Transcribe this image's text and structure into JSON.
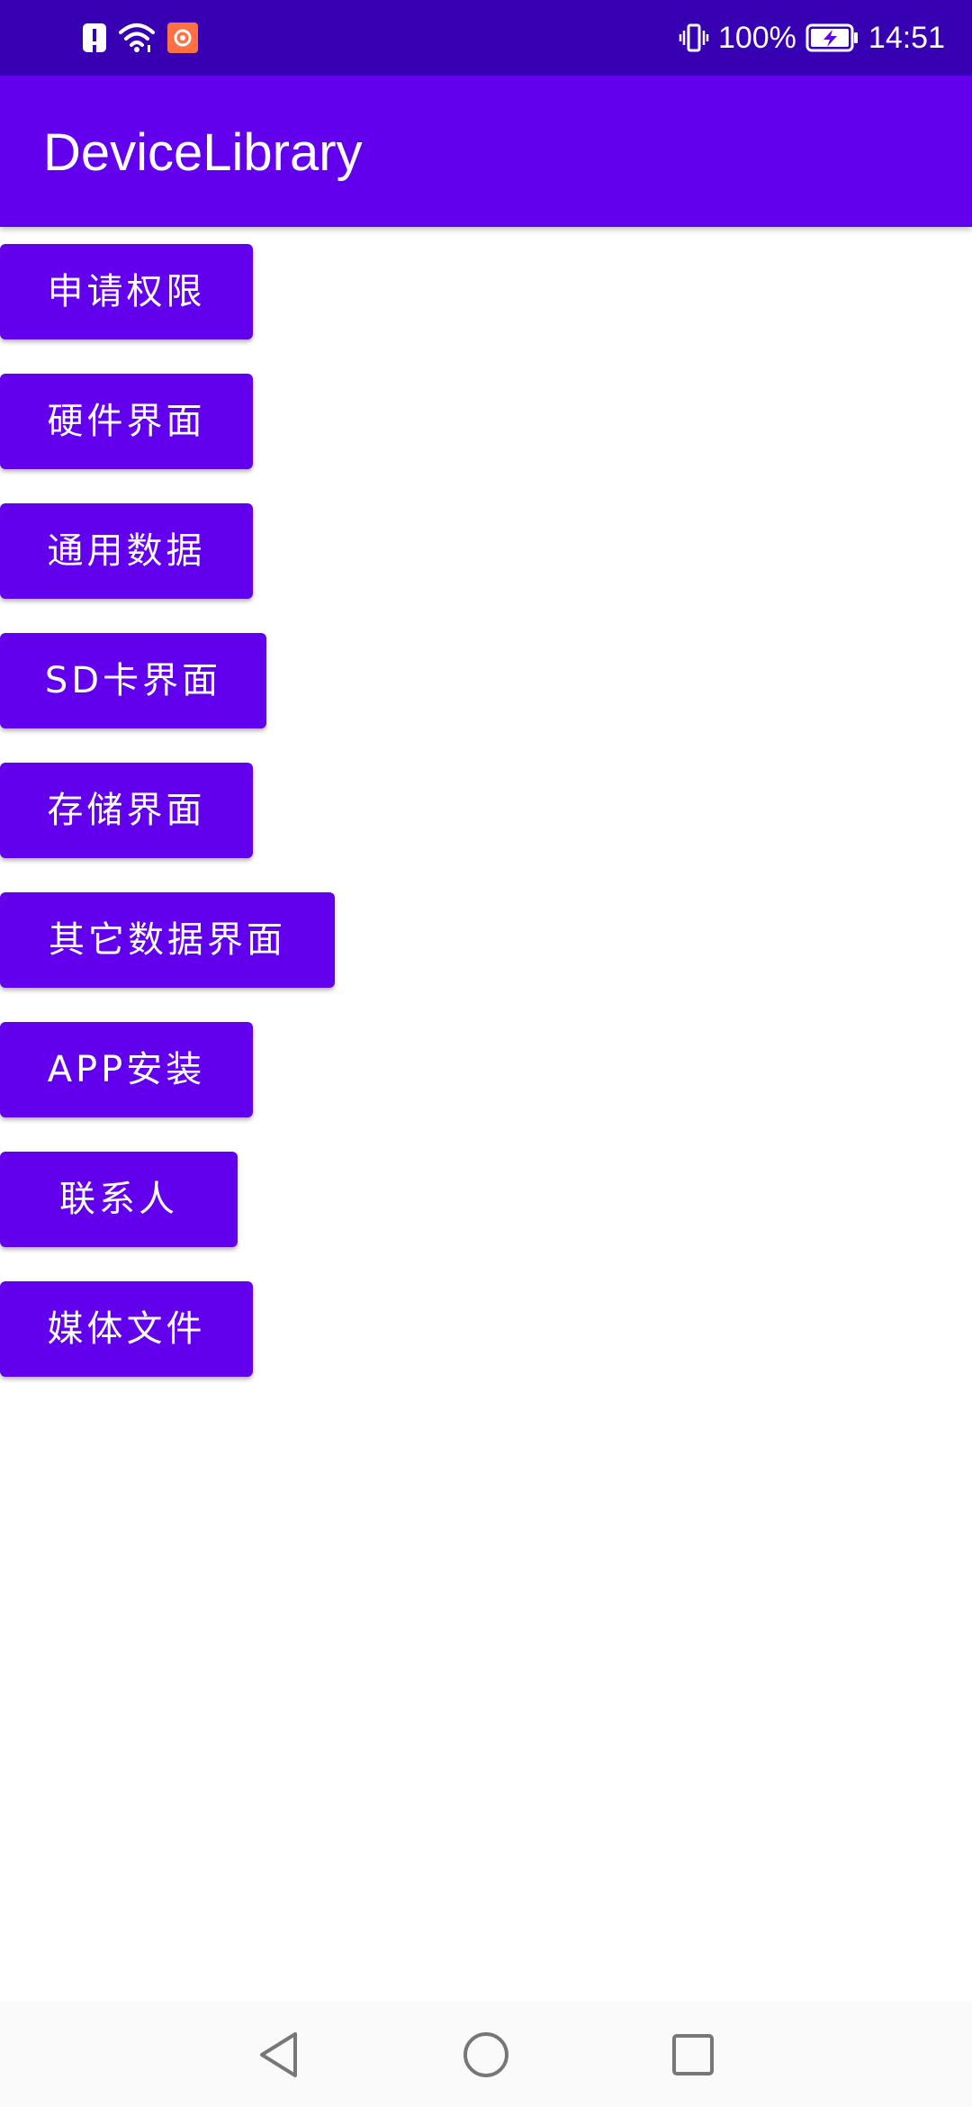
{
  "status_bar": {
    "battery_percent": "100%",
    "time": "14:51",
    "icons": [
      "alert-icon",
      "wifi-icon",
      "app-notification-icon",
      "vibrate-icon",
      "battery-charging-icon"
    ]
  },
  "app_bar": {
    "title": "DeviceLibrary"
  },
  "buttons": [
    {
      "label": "申请权限"
    },
    {
      "label": "硬件界面"
    },
    {
      "label": "通用数据"
    },
    {
      "label": "SD卡界面"
    },
    {
      "label": "存储界面"
    },
    {
      "label": "其它数据界面"
    },
    {
      "label": "APP安装"
    },
    {
      "label": "联系人"
    },
    {
      "label": "媒体文件"
    }
  ],
  "nav_bar": {
    "icons": [
      "back-icon",
      "home-icon",
      "recents-icon"
    ]
  },
  "colors": {
    "status_bar": "#3700b3",
    "primary": "#6200ee",
    "on_primary": "#ffffff",
    "background": "#ffffff"
  }
}
